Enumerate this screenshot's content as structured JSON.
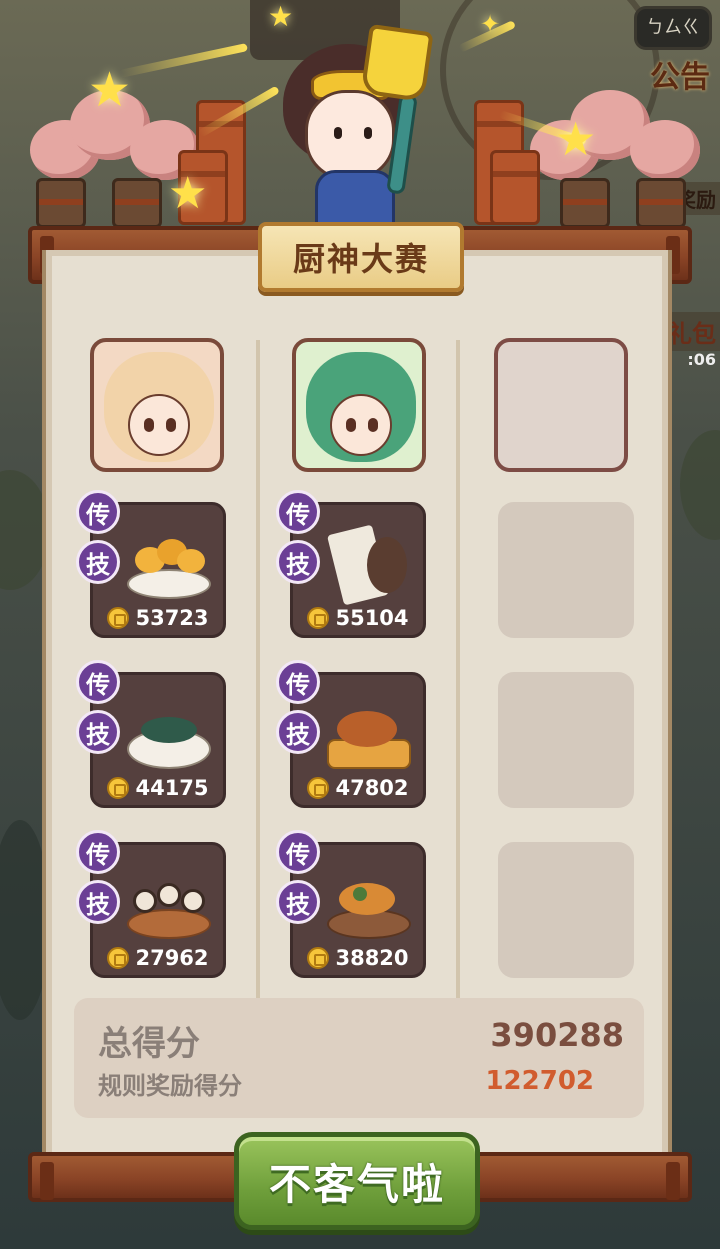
{
  "panel": {
    "title": "厨神大赛"
  },
  "side": {
    "notice_bubble": "ㄅㄙㄍ",
    "notice_label": "公告",
    "reward_fragment": "奖励",
    "gift_fragment": "礼包",
    "timer_fragment": ":06"
  },
  "columns": [
    {
      "avatar": "chef-girl-avatar",
      "dishes": [
        {
          "badge_top": "传",
          "badge_bottom": "技",
          "dish": "fried-buns",
          "score": "53723"
        },
        {
          "badge_top": "传",
          "badge_bottom": "技",
          "dish": "green-bean-bowl",
          "score": "44175"
        },
        {
          "badge_top": "传",
          "badge_bottom": "技",
          "dish": "panda-dumplings",
          "score": "27962"
        }
      ]
    },
    {
      "avatar": "green-hair-chef-avatar",
      "dishes": [
        {
          "badge_top": "传",
          "badge_bottom": "技",
          "dish": "poster-recipe",
          "score": "55104"
        },
        {
          "badge_top": "传",
          "badge_bottom": "技",
          "dish": "roast-duck",
          "score": "47802"
        },
        {
          "badge_top": "传",
          "badge_bottom": "技",
          "dish": "stir-fry-platter",
          "score": "38820"
        }
      ]
    },
    {
      "avatar": "empty",
      "dishes": []
    }
  ],
  "summary": {
    "total_label": "总得分",
    "total_value": "390288",
    "bonus_label": "规则奖励得分",
    "bonus_value": "122702"
  },
  "actions": {
    "confirm_label": "不客气啦"
  },
  "colors": {
    "panel": "#e6dfd1",
    "card": "#55403e",
    "badge": "#6b3f95",
    "bonus": "#d15c2e",
    "button": "#6f9f3b"
  }
}
